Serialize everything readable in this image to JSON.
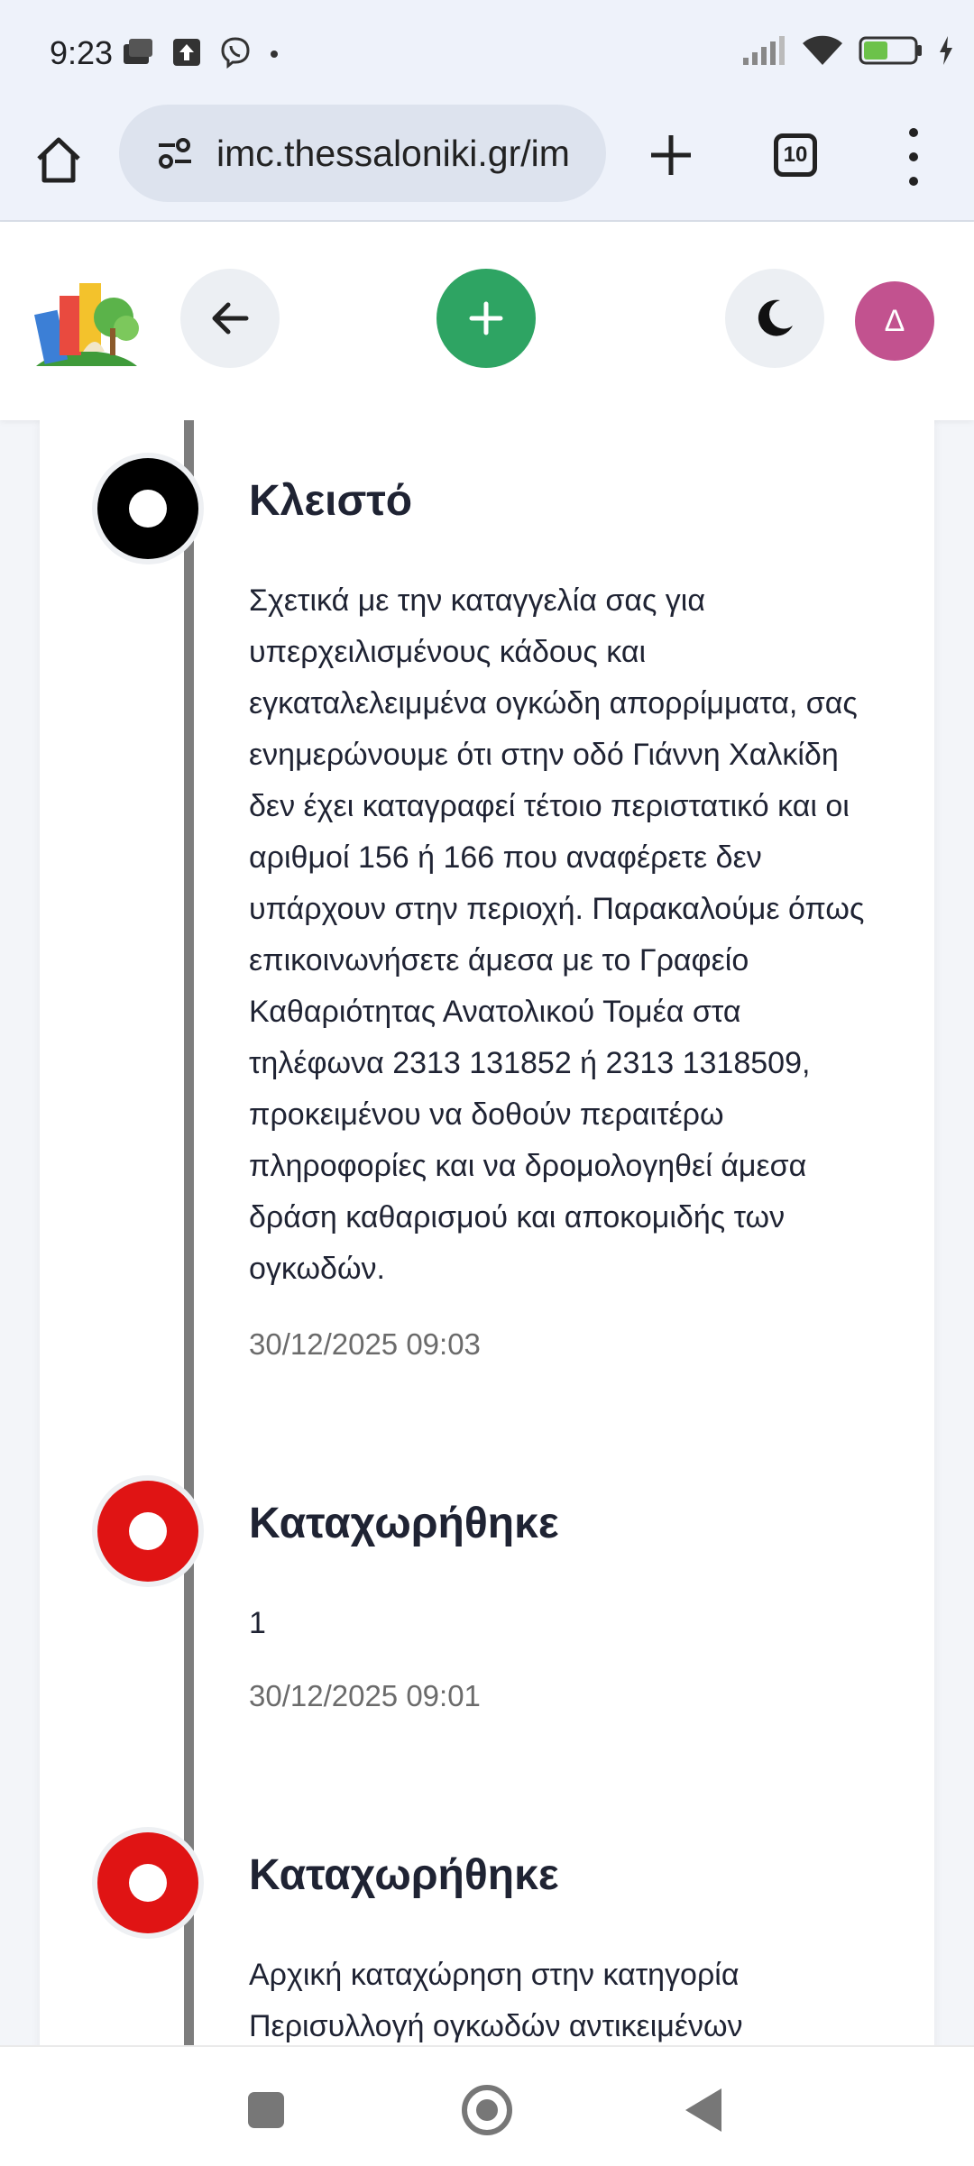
{
  "status_bar": {
    "time": "9:23",
    "battery": "44",
    "icons": [
      "news-icon",
      "upload-icon",
      "viber-icon",
      "dot-icon",
      "signal-icon",
      "wifi-icon",
      "battery-icon",
      "charging-icon"
    ]
  },
  "browser": {
    "url": "imc.thessaloniki.gr/im",
    "tab_count": "10"
  },
  "header": {
    "avatar_initial": "Δ",
    "accent_color": "#2ea463",
    "avatar_color": "#c2528f"
  },
  "timeline": [
    {
      "status": "Κλειστό",
      "marker_color": "#000000",
      "body": "Σχετικά με την καταγγελία σας για υπερχειλισμένους κάδους και εγκαταλελειμμένα ογκώδη απορρίμματα, σας ενημερώνουμε ότι στην οδό Γιάννη Χαλκίδη δεν έχει καταγραφεί τέτοιο περιστατικό και οι αριθμοί 156 ή 166 που αναφέρετε δεν υπάρχουν στην περιοχή. Παρακαλούμε όπως επικοινωνήσετε άμεσα με το Γραφείο Καθαριότητας Ανατολικού Τομέα στα τηλέφωνα 2313 131852 ή 2313 1318509, προκειμένου να δοθούν περαιτέρω πληροφορίες και να δρομολογηθεί άμεσα δράση καθαρισμού και αποκομιδής των ογκωδών.",
      "timestamp": "30/12/2025 09:03"
    },
    {
      "status": "Καταχωρήθηκε",
      "marker_color": "#e01414",
      "body": "1",
      "timestamp": "30/12/2025 09:01"
    },
    {
      "status": "Καταχωρήθηκε",
      "marker_color": "#e01414",
      "body": "Αρχική καταχώρηση στην κατηγορία Περισυλλογή ογκωδών αντικειμένων",
      "timestamp": ""
    }
  ]
}
